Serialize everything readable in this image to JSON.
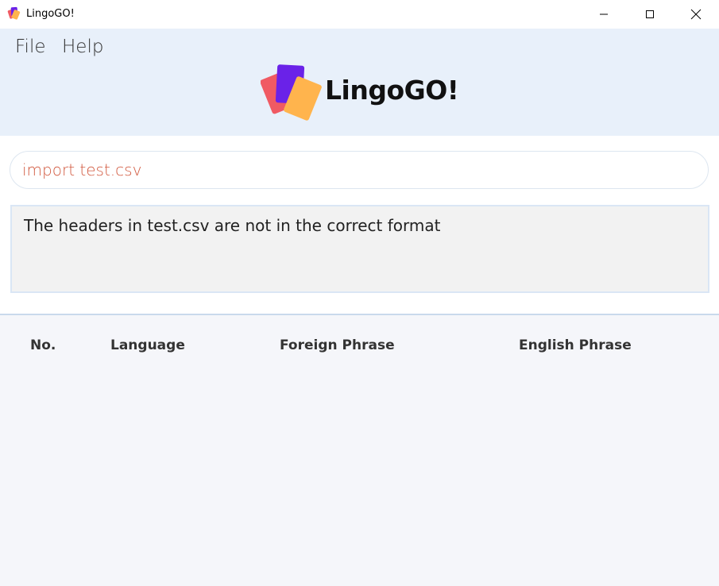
{
  "window": {
    "title": "LingoGO!"
  },
  "menu": {
    "file_label": "File",
    "help_label": "Help"
  },
  "logo": {
    "text": "LingoGO!"
  },
  "command": {
    "value": "import test.csv",
    "text_color": "#d25a40"
  },
  "result": {
    "message": "The headers in test.csv are not in the correct format"
  },
  "table": {
    "columns": [
      "No.",
      "Language",
      "Foreign Phrase",
      "English Phrase"
    ],
    "rows": []
  },
  "colors": {
    "header_bg": "#e8f0fa",
    "card_red": "#f05a63",
    "card_purple": "#6a22e8",
    "card_orange": "#ffb44d",
    "table_bg": "#f5f6fa"
  },
  "icons": {
    "app": "lingogo-cards-icon",
    "minimize": "minimize-icon",
    "maximize": "maximize-icon",
    "close": "close-icon"
  }
}
